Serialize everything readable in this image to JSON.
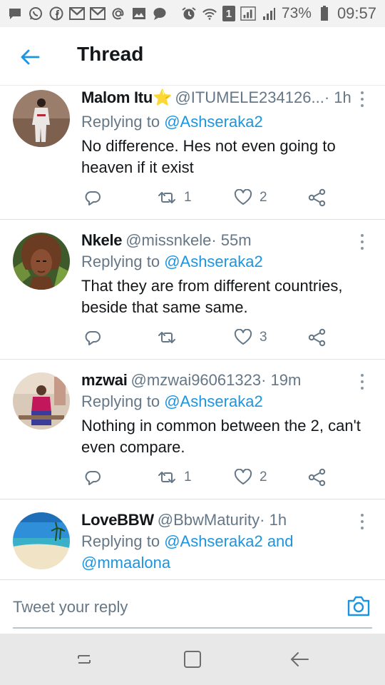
{
  "status_bar": {
    "battery": "73%",
    "time": "09:57",
    "sim_badge": "1",
    "notification_icons": [
      "message-icon",
      "whatsapp-icon",
      "facebook-icon",
      "gmail-icon",
      "gmail-icon",
      "at-sign-icon",
      "gallery-icon",
      "chat-icon"
    ],
    "system_icons": [
      "alarm-icon",
      "wifi-icon",
      "sim-icon",
      "signal-icon",
      "signal-icon",
      "battery-icon"
    ]
  },
  "header": {
    "title": "Thread",
    "back_icon": "arrow-left-icon"
  },
  "colors": {
    "accent": "#1b95e0",
    "secondary_text": "#657786",
    "divider": "#dfe3e6",
    "star": "#f5c518"
  },
  "tweets": [
    {
      "name": "Malom Itu",
      "badge": "⭐",
      "handle": "@ITUMELE234126...",
      "time": " · 1h",
      "replying_prefix": "Replying to ",
      "replying_to": "@Ashseraka2",
      "replying_and": "",
      "replying_to_2": "",
      "text": "No difference. Hes not even going to heaven if it exist",
      "retweets": "1",
      "likes": "2"
    },
    {
      "name": "Nkele",
      "badge": "",
      "handle": "@missnkele",
      "time": " · 55m",
      "replying_prefix": "Replying to ",
      "replying_to": "@Ashseraka2",
      "replying_and": "",
      "replying_to_2": "",
      "text": "That they are from different countries, beside that same same.",
      "retweets": "",
      "likes": "3"
    },
    {
      "name": "mzwai",
      "badge": "",
      "handle": "@mzwai96061323",
      "time": " · 19m",
      "replying_prefix": "Replying to ",
      "replying_to": "@Ashseraka2",
      "replying_and": "",
      "replying_to_2": "",
      "text": "Nothing in common between the 2, can't even compare.",
      "retweets": "1",
      "likes": "2"
    },
    {
      "name": "LoveBBW",
      "badge": "",
      "handle": "@BbwMaturity",
      "time": " · 1h",
      "replying_prefix": "Replying to ",
      "replying_to": "@Ashseraka2",
      "replying_and": " and ",
      "replying_to_2": "@mmaalona",
      "text": "",
      "retweets": "",
      "likes": ""
    }
  ],
  "composer": {
    "placeholder": "Tweet your reply"
  }
}
